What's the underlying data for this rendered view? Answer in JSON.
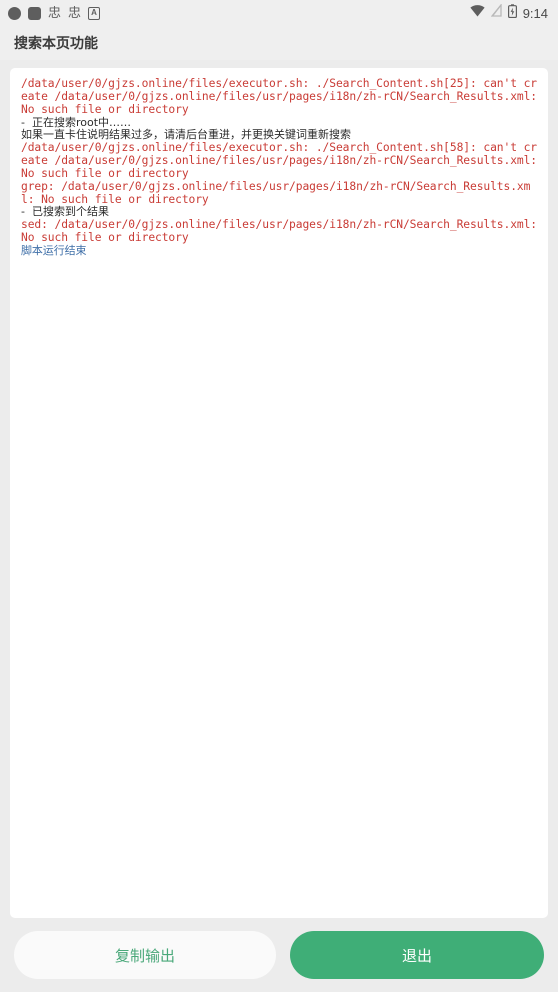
{
  "status_bar": {
    "left_icons": [
      {
        "name": "circle-icon",
        "glyph": ""
      },
      {
        "name": "rounded-square-icon",
        "glyph": ""
      },
      {
        "name": "chinese-glyph-icon-1",
        "glyph": "忠"
      },
      {
        "name": "chinese-glyph-icon-2",
        "glyph": "忠"
      },
      {
        "name": "boxed-a-icon",
        "glyph": "A"
      }
    ],
    "wifi_icon": "wifi-icon",
    "signal_off_icon": "signal-off-icon",
    "battery_icon": "battery-charging-icon",
    "time": "9:14"
  },
  "header": {
    "title": "搜索本页功能"
  },
  "output": {
    "lines": [
      {
        "text": "/data/user/0/gjzs.online/files/executor.sh: ./Search_Content.sh[25]: can't create /data/user/0/gjzs.online/files/usr/pages/i18n/zh-rCN/Search_Results.xml: No such file or directory",
        "style": "err"
      },
      {
        "text": "-  正在搜索root中……",
        "style": "info"
      },
      {
        "text": "如果一直卡住说明结果过多，请清后台重进，并更换关键词重新搜索",
        "style": "info"
      },
      {
        "text": "/data/user/0/gjzs.online/files/executor.sh: ./Search_Content.sh[58]: can't create /data/user/0/gjzs.online/files/usr/pages/i18n/zh-rCN/Search_Results.xml: No such file or directory",
        "style": "err"
      },
      {
        "text": "grep: /data/user/0/gjzs.online/files/usr/pages/i18n/zh-rCN/Search_Results.xml: No such file or directory",
        "style": "err"
      },
      {
        "text": "-  已搜索到个结果",
        "style": "info"
      },
      {
        "text": "sed: /data/user/0/gjzs.online/files/usr/pages/i18n/zh-rCN/Search_Results.xml: No such file or directory",
        "style": "err"
      },
      {
        "text": "脚本运行结束",
        "style": "note"
      }
    ]
  },
  "buttons": {
    "copy_label": "复制输出",
    "exit_label": "退出"
  },
  "colors": {
    "page_background": "#ececec",
    "header_background": "#efefef",
    "card_background": "#ffffff",
    "error_text": "#c93c36",
    "info_text": "#2b2b2b",
    "note_text": "#3f6fa8",
    "accent_green": "#3fae77",
    "secondary_button_background": "#fafafa"
  }
}
